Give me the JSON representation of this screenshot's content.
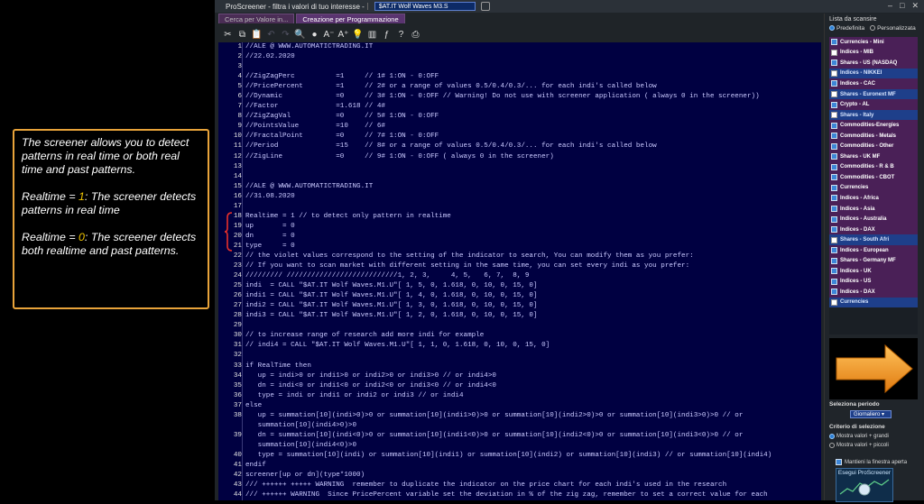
{
  "note": {
    "p1": "The screener allows you to detect patterns in real time or both real time and past patterns.",
    "p2_before": "Realtime = ",
    "p2_value": "1",
    "p2_after": ": The screener detects patterns in real time",
    "p3_before": "Realtime = ",
    "p3_value": "0",
    "p3_after": ": The screener detects both realtime and past patterns."
  },
  "window": {
    "app_title": "ProScreener - filtra i valori di tuo interesse -",
    "screener_name": "$AT.IT Wolf Waves M3.S",
    "controls": [
      "–",
      "□",
      "✕"
    ]
  },
  "tabs": [
    {
      "label": "Cerca per Valore in..."
    },
    {
      "label": "Creazione per Programmazione",
      "active": true
    }
  ],
  "toolbar": {
    "icons": [
      "scissors-icon",
      "copy-icon",
      "paste-icon",
      "undo-icon",
      "redo-icon",
      "search-icon",
      "comment-icon",
      "font-decrease-icon",
      "font-increase-icon",
      "bulb-icon",
      "bars-icon",
      "function-icon",
      "help-icon",
      "print-icon"
    ],
    "glyphs": [
      "✂",
      "⧉",
      "📋",
      "↶",
      "↷",
      "🔍",
      "●",
      "A⁻",
      "A⁺",
      "💡",
      "▥",
      "ƒ",
      "?",
      "⎙"
    ]
  },
  "code_lines": [
    {
      "n": "1",
      "t": "//ALE @ WWW.AUTOMATICTRADING.IT"
    },
    {
      "n": "2",
      "t": "//22.02.2020"
    },
    {
      "n": "3",
      "t": ""
    },
    {
      "n": "4",
      "t": "//ZigZagPerc          =1     // 1# 1:ON - 0:OFF"
    },
    {
      "n": "5",
      "t": "//PricePercent        =1     // 2# or a range of values 0.5/0.4/0.3/... for each indi's called below"
    },
    {
      "n": "6",
      "t": "//Dynamic             =0     // 3# 1:ON - 0:OFF // Warning! Do not use with screener application ( always 0 in the screener))"
    },
    {
      "n": "7",
      "t": "//Factor              =1.618 // 4#"
    },
    {
      "n": "8",
      "t": "//ZigZagVal           =0     // 5# 1:ON - 0:OFF"
    },
    {
      "n": "9",
      "t": "//PointsValue         =10    // 6#"
    },
    {
      "n": "10",
      "t": "//FractalPoint        =0     // 7# 1:ON - 0:OFF"
    },
    {
      "n": "11",
      "t": "//Period              =15    // 8# or a range of values 0.5/0.4/0.3/... for each indi's called below"
    },
    {
      "n": "12",
      "t": "//ZigLine             =0     // 9# 1:ON - 0:OFF ( always 0 in the screener)"
    },
    {
      "n": "13",
      "t": ""
    },
    {
      "n": "14",
      "t": ""
    },
    {
      "n": "15",
      "t": "//ALE @ WWW.AUTOMATICTRADING.IT"
    },
    {
      "n": "16",
      "t": "//31.08.2020"
    },
    {
      "n": "17",
      "t": ""
    },
    {
      "n": "18",
      "t": "Realtime = 1 // to detect only pattern in realtime"
    },
    {
      "n": "19",
      "t": "up       = 0"
    },
    {
      "n": "20",
      "t": "dn       = 0"
    },
    {
      "n": "21",
      "t": "type     = 0"
    },
    {
      "n": "22",
      "t": "// the violet values correspond to the setting of the indicator to search, You can modify them as you prefer:"
    },
    {
      "n": "23",
      "t": "// If you want to scan market with different setting in the same time, you can set every indi as you prefer:"
    },
    {
      "n": "24",
      "t": "///////// ///////////////////////////1, 2, 3,     4, 5,   6, 7,  8, 9"
    },
    {
      "n": "25",
      "t": "indi  = CALL \"$AT.IT Wolf Waves.M1.U\"[ 1, 5, 0, 1.618, 0, 10, 0, 15, 0]"
    },
    {
      "n": "26",
      "t": "indi1 = CALL \"$AT.IT Wolf Waves.M1.U\"[ 1, 4, 0, 1.618, 0, 10, 0, 15, 0]"
    },
    {
      "n": "27",
      "t": "indi2 = CALL \"$AT.IT Wolf Waves.M1.U\"[ 1, 3, 0, 1.618, 0, 10, 0, 15, 0]"
    },
    {
      "n": "28",
      "t": "indi3 = CALL \"$AT.IT Wolf Waves.M1.U\"[ 1, 2, 0, 1.618, 0, 10, 0, 15, 0]"
    },
    {
      "n": "29",
      "t": ""
    },
    {
      "n": "30",
      "t": "// to increase range of research add more indi for example"
    },
    {
      "n": "31",
      "t": "// indi4 = CALL \"$AT.IT Wolf Waves.M1.U\"[ 1, 1, 0, 1.618, 0, 10, 0, 15, 0]"
    },
    {
      "n": "32",
      "t": ""
    },
    {
      "n": "33",
      "t": "if RealTime then"
    },
    {
      "n": "34",
      "t": "   up = indi>0 or indi1>0 or indi2>0 or indi3>0 // or indi4>0"
    },
    {
      "n": "35",
      "t": "   dn = indi<0 or indi1<0 or indi2<0 or indi3<0 // or indi4<0"
    },
    {
      "n": "36",
      "t": "   type = indi or indi1 or indi2 or indi3 // or indi4"
    },
    {
      "n": "37",
      "t": "else"
    },
    {
      "n": "38",
      "t": "   up = summation[10](indi>0)>0 or summation[10](indi1>0)>0 or summation[10](indi2>0)>0 or summation[10](indi3>0)>0 // or"
    },
    {
      "n": "",
      "t": "   summation[10](indi4>0)>0"
    },
    {
      "n": "39",
      "t": "   dn = summation[10](indi<0)>0 or summation[10](indi1<0)>0 or summation[10](indi2<0)>0 or summation[10](indi3<0)>0 // or"
    },
    {
      "n": "",
      "t": "   summation[10](indi4<0)>0"
    },
    {
      "n": "40",
      "t": "   type = summation[10](indi) or summation[10](indi1) or summation[10](indi2) or summation[10](indi3) // or summation[10](indi4)"
    },
    {
      "n": "41",
      "t": "endif"
    },
    {
      "n": "42",
      "t": "screener[up or dn](type*1000)"
    },
    {
      "n": "43",
      "t": "/// ++++++ +++++ WARNING  remember to duplicate the indicator on the price chart for each indi's used in the research"
    },
    {
      "n": "44",
      "t": "/// ++++++ WARNING  Since PricePercent variable set the deviation in % of the zig zag, remember to set a correct value for each"
    }
  ],
  "sidebar": {
    "title": "Lista da scansire",
    "radio_predefinita": "Predefinita",
    "radio_personalizzata": "Personalizzata",
    "items": [
      {
        "label": "Currencies - Mini",
        "checked": true,
        "style": "purple"
      },
      {
        "label": "Indices - MIB",
        "checked": false,
        "style": "purple"
      },
      {
        "label": "Shares - US (NASDAQ",
        "checked": true,
        "style": "purple"
      },
      {
        "label": "Indices - NIKKEI",
        "checked": false,
        "style": "blue"
      },
      {
        "label": "Indices - CAC",
        "checked": true,
        "style": "purple"
      },
      {
        "label": "Shares - Euronext MF",
        "checked": false,
        "style": "blue"
      },
      {
        "label": "Crypto - AL",
        "checked": true,
        "style": "purple"
      },
      {
        "label": "Shares - Italy",
        "checked": false,
        "style": "blue"
      },
      {
        "label": "Commodities-Energies",
        "checked": true,
        "style": "purple"
      },
      {
        "label": "Commodities - Metals",
        "checked": true,
        "style": "purple"
      },
      {
        "label": "Commodities - Other",
        "checked": true,
        "style": "purple"
      },
      {
        "label": "Shares - UK MF",
        "checked": true,
        "style": "purple"
      },
      {
        "label": "Commodities - R & B",
        "checked": true,
        "style": "purple"
      },
      {
        "label": "Commodities - CBOT",
        "checked": true,
        "style": "purple"
      },
      {
        "label": "Currencies",
        "checked": true,
        "style": "purple"
      },
      {
        "label": "Indices - Africa",
        "checked": true,
        "style": "purple"
      },
      {
        "label": "Indices - Asia",
        "checked": true,
        "style": "purple"
      },
      {
        "label": "Indices - Australia",
        "checked": true,
        "style": "purple"
      },
      {
        "label": "Indices - DAX",
        "checked": true,
        "style": "purple"
      },
      {
        "label": "Shares - South Afri",
        "checked": false,
        "style": "blue"
      },
      {
        "label": "Indices - European",
        "checked": true,
        "style": "purple"
      },
      {
        "label": "Shares - Germany MF",
        "checked": true,
        "style": "purple"
      },
      {
        "label": "Indices - UK",
        "checked": true,
        "style": "purple"
      },
      {
        "label": "Indices - US",
        "checked": true,
        "style": "purple"
      },
      {
        "label": "Indices - DAX",
        "checked": true,
        "style": "purple"
      },
      {
        "label": "Currencies",
        "checked": false,
        "style": "blue"
      }
    ],
    "period_title": "Seleziona periodo",
    "period_value": "Giornaliero",
    "criteria_title": "Criterio di selezione",
    "criteria_high": "Mostra valori + grandi",
    "criteria_low": "Mostra valori + piccoli",
    "keep_open": "Mantieni la finestra aperta",
    "run_button": "Esegui ProScreener"
  },
  "colors": {
    "note_border": "#e8a33a",
    "note_highlight": "#f0c400",
    "editor_bg": "#000041",
    "code_text": "#c9c9ff",
    "arrow": "#f39a1e"
  }
}
